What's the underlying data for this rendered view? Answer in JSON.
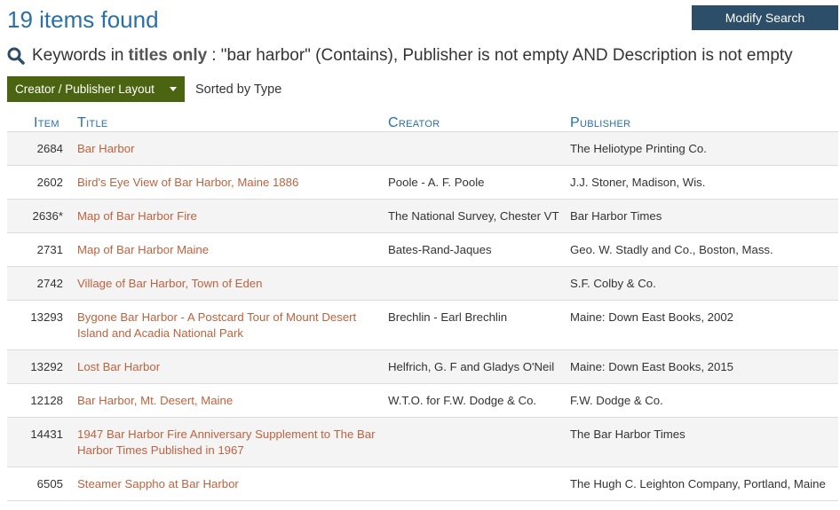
{
  "header": {
    "result_count": "19 items found",
    "modify_label": "Modify Search"
  },
  "criteria": {
    "prefix": "Keywords in",
    "emphasis": "titles only",
    "rest": ": \"bar harbor\" (Contains), Publisher is not empty AND Description is not empty"
  },
  "toolbar": {
    "layout_label": "Creator / Publisher Layout",
    "sorted_label": "Sorted by Type"
  },
  "table": {
    "columns": [
      "Item",
      "Title",
      "Creator",
      "Publisher"
    ],
    "rows": [
      {
        "item": "2684",
        "title": "Bar Harbor",
        "creator": "",
        "publisher": "The Heliotype Printing Co."
      },
      {
        "item": "2602",
        "title": "Bird's Eye View of Bar Harbor, Maine 1886",
        "creator": "Poole - A. F. Poole",
        "publisher": "J.J. Stoner, Madison, Wis."
      },
      {
        "item": "2636*",
        "title": "Map of Bar Harbor Fire",
        "creator": "The National Survey, Chester VT",
        "publisher": "Bar Harbor Times"
      },
      {
        "item": "2731",
        "title": "Map of Bar Harbor Maine",
        "creator": "Bates-Rand-Jaques",
        "publisher": "Geo. W. Stadly and Co., Boston, Mass."
      },
      {
        "item": "2742",
        "title": "Village of Bar Harbor, Town of Eden",
        "creator": "",
        "publisher": "S.F. Colby & Co."
      },
      {
        "item": "13293",
        "title": "Bygone Bar Harbor - A Postcard Tour of Mount Desert Island and Acadia National Park",
        "creator": "Brechlin - Earl Brechlin",
        "publisher": "Maine: Down East Books, 2002"
      },
      {
        "item": "13292",
        "title": "Lost Bar Harbor",
        "creator": "Helfrich, G. F and Gladys O'Neil",
        "publisher": "Maine: Down East Books, 2015"
      },
      {
        "item": "12128",
        "title": "Bar Harbor, Mt. Desert, Maine",
        "creator": "W.T.O. for F.W. Dodge & Co.",
        "publisher": "F.W. Dodge & Co."
      },
      {
        "item": "14431",
        "title": "1947 Bar Harbor Fire Anniversary Supplement to The Bar Harbor Times Published in 1967",
        "creator": "",
        "publisher": "The Bar Harbor Times"
      },
      {
        "item": "6505",
        "title": "Steamer Sappho at Bar Harbor",
        "creator": "",
        "publisher": "The Hugh C. Leighton Company, Portland, Maine"
      }
    ]
  },
  "colors": {
    "heading_blue": "#2a6fa8",
    "link_orange": "#c0613e",
    "modify_button": "#2c4e68",
    "layout_button": "#4b6411",
    "row_stripe": "#f4f4f4"
  },
  "icons": {
    "criteria": "search-icon",
    "layout_dropdown": "caret-down-icon"
  }
}
